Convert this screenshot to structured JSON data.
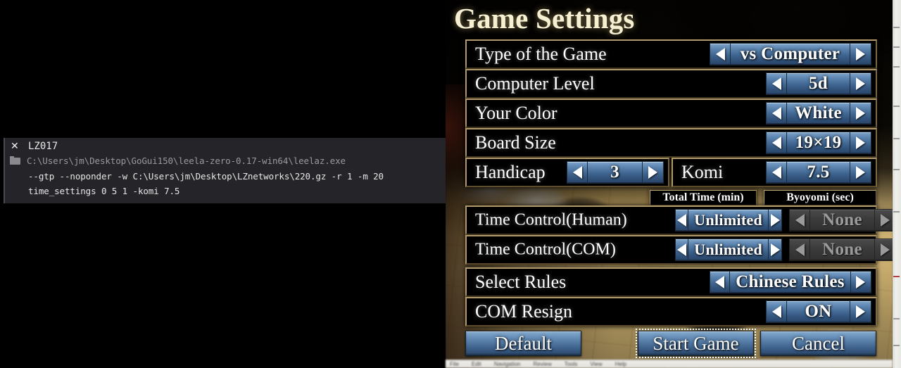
{
  "console": {
    "close_icon": "close-icon",
    "title": "LZ017",
    "folder_icon": "folder-icon",
    "command_path": "C:\\Users\\jm\\Desktop\\GoGui150\\leela-zero-0.17-win64\\leelaz.exe",
    "args_line1": "--gtp --noponder -w C:\\Users\\jm\\Desktop\\LZnetworks\\220.gz -r 1 -m 20",
    "args_line2": "time_settings 0 5 1 -komi 7.5"
  },
  "dialog": {
    "title": "Game Settings",
    "colheads": {
      "total_time": "Total Time (min)",
      "byoyomi": "Byoyomi (sec)"
    },
    "rows": [
      {
        "label": "Type of the Game",
        "value": "vs Computer"
      },
      {
        "label": "Computer Level",
        "value": "5d"
      },
      {
        "label": "Your Color",
        "value": "White"
      },
      {
        "label": "Board Size",
        "value": "19×19"
      },
      {
        "label": "Handicap",
        "value": "3"
      },
      {
        "label": "Komi",
        "value": "7.5"
      },
      {
        "label": "Time Control(Human)",
        "value": "Unlimited",
        "value2": "None"
      },
      {
        "label": "Time Control(COM)",
        "value": "Unlimited",
        "value2": "None"
      },
      {
        "label": "Select Rules",
        "value": "Chinese Rules"
      },
      {
        "label": "COM Resign",
        "value": "ON"
      }
    ],
    "buttons": {
      "default": "Default",
      "start": "Start Game",
      "cancel": "Cancel"
    },
    "arrows": {
      "left": "arrow-left-icon",
      "right": "arrow-right-icon"
    }
  },
  "menu_strip": {
    "items": [
      "File",
      "Edit",
      "Navigation",
      "Review",
      "Tools",
      "View",
      "Help"
    ]
  },
  "colors": {
    "row_border": "#b29a6b",
    "button_blue": "#4a709a",
    "title_cream": "#f6efd2",
    "disabled_gray": "#9a9a9a"
  }
}
